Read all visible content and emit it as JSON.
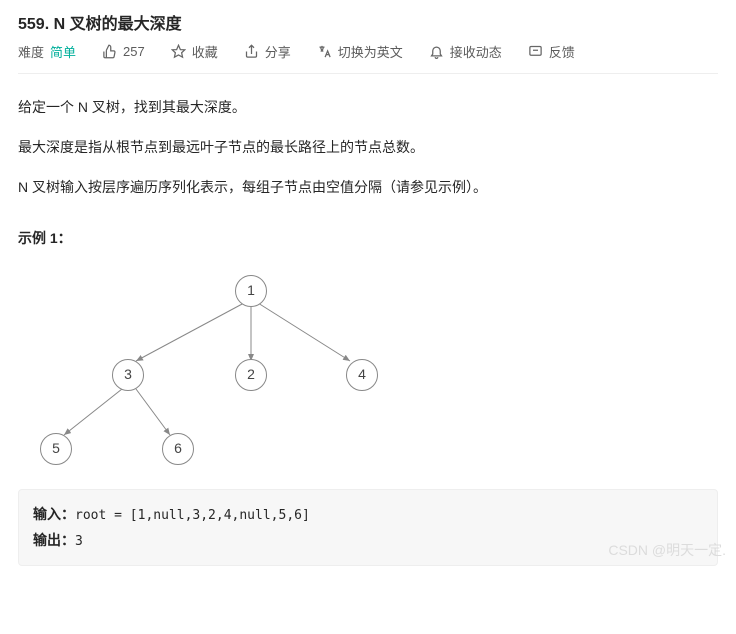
{
  "title": "559. N 叉树的最大深度",
  "meta": {
    "difficulty_label": "难度",
    "difficulty_value": "简单",
    "likes": "257",
    "favorite": "收藏",
    "share": "分享",
    "switch_lang": "切换为英文",
    "notify": "接收动态",
    "feedback": "反馈"
  },
  "description": {
    "p1": "给定一个 N 叉树，找到其最大深度。",
    "p2": "最大深度是指从根节点到最远叶子节点的最长路径上的节点总数。",
    "p3": "N 叉树输入按层序遍历序列化表示，每组子节点由空值分隔（请参见示例）。"
  },
  "example": {
    "heading": "示例 1：",
    "tree_nodes": {
      "n1": "1",
      "n3": "3",
      "n2": "2",
      "n4": "4",
      "n5": "5",
      "n6": "6"
    },
    "input_label": "输入：",
    "input_code": "root = [1,null,3,2,4,null,5,6]",
    "output_label": "输出：",
    "output_value": "3"
  },
  "watermark": "CSDN @明天一定."
}
